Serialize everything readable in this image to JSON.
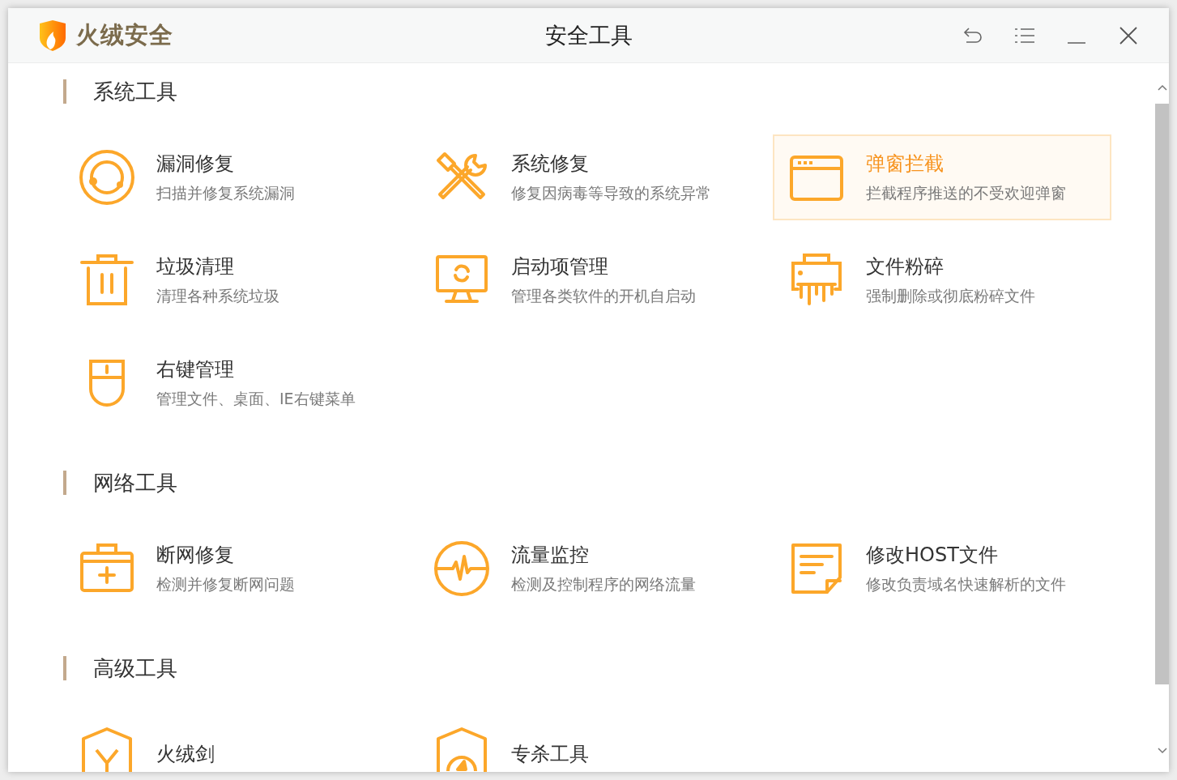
{
  "window": {
    "brand": "火绒安全",
    "title": "安全工具"
  },
  "sections": [
    {
      "title": "系统工具",
      "tools": [
        {
          "kind": "vulnerability",
          "name": "漏洞修复",
          "desc": "扫描并修复系统漏洞",
          "selected": false
        },
        {
          "kind": "system-repair",
          "name": "系统修复",
          "desc": "修复因病毒等导致的系统异常",
          "selected": false
        },
        {
          "kind": "popup",
          "name": "弹窗拦截",
          "desc": "拦截程序推送的不受欢迎弹窗",
          "selected": true
        },
        {
          "kind": "junk",
          "name": "垃圾清理",
          "desc": "清理各种系统垃圾",
          "selected": false
        },
        {
          "kind": "startup",
          "name": "启动项管理",
          "desc": "管理各类软件的开机自启动",
          "selected": false
        },
        {
          "kind": "shredder",
          "name": "文件粉碎",
          "desc": "强制删除或彻底粉碎文件",
          "selected": false
        },
        {
          "kind": "context-menu",
          "name": "右键管理",
          "desc": "管理文件、桌面、IE右键菜单",
          "selected": false
        }
      ]
    },
    {
      "title": "网络工具",
      "tools": [
        {
          "kind": "network-repair",
          "name": "断网修复",
          "desc": "检测并修复断网问题",
          "selected": false
        },
        {
          "kind": "traffic",
          "name": "流量监控",
          "desc": "检测及控制程序的网络流量",
          "selected": false
        },
        {
          "kind": "hosts",
          "name": "修改HOST文件",
          "desc": "修改负责域名快速解析的文件",
          "selected": false
        }
      ]
    },
    {
      "title": "高级工具",
      "tools": [
        {
          "kind": "sword",
          "name": "火绒剑",
          "selected": false
        },
        {
          "kind": "kill-tool",
          "name": "专杀工具",
          "selected": false
        }
      ]
    }
  ]
}
